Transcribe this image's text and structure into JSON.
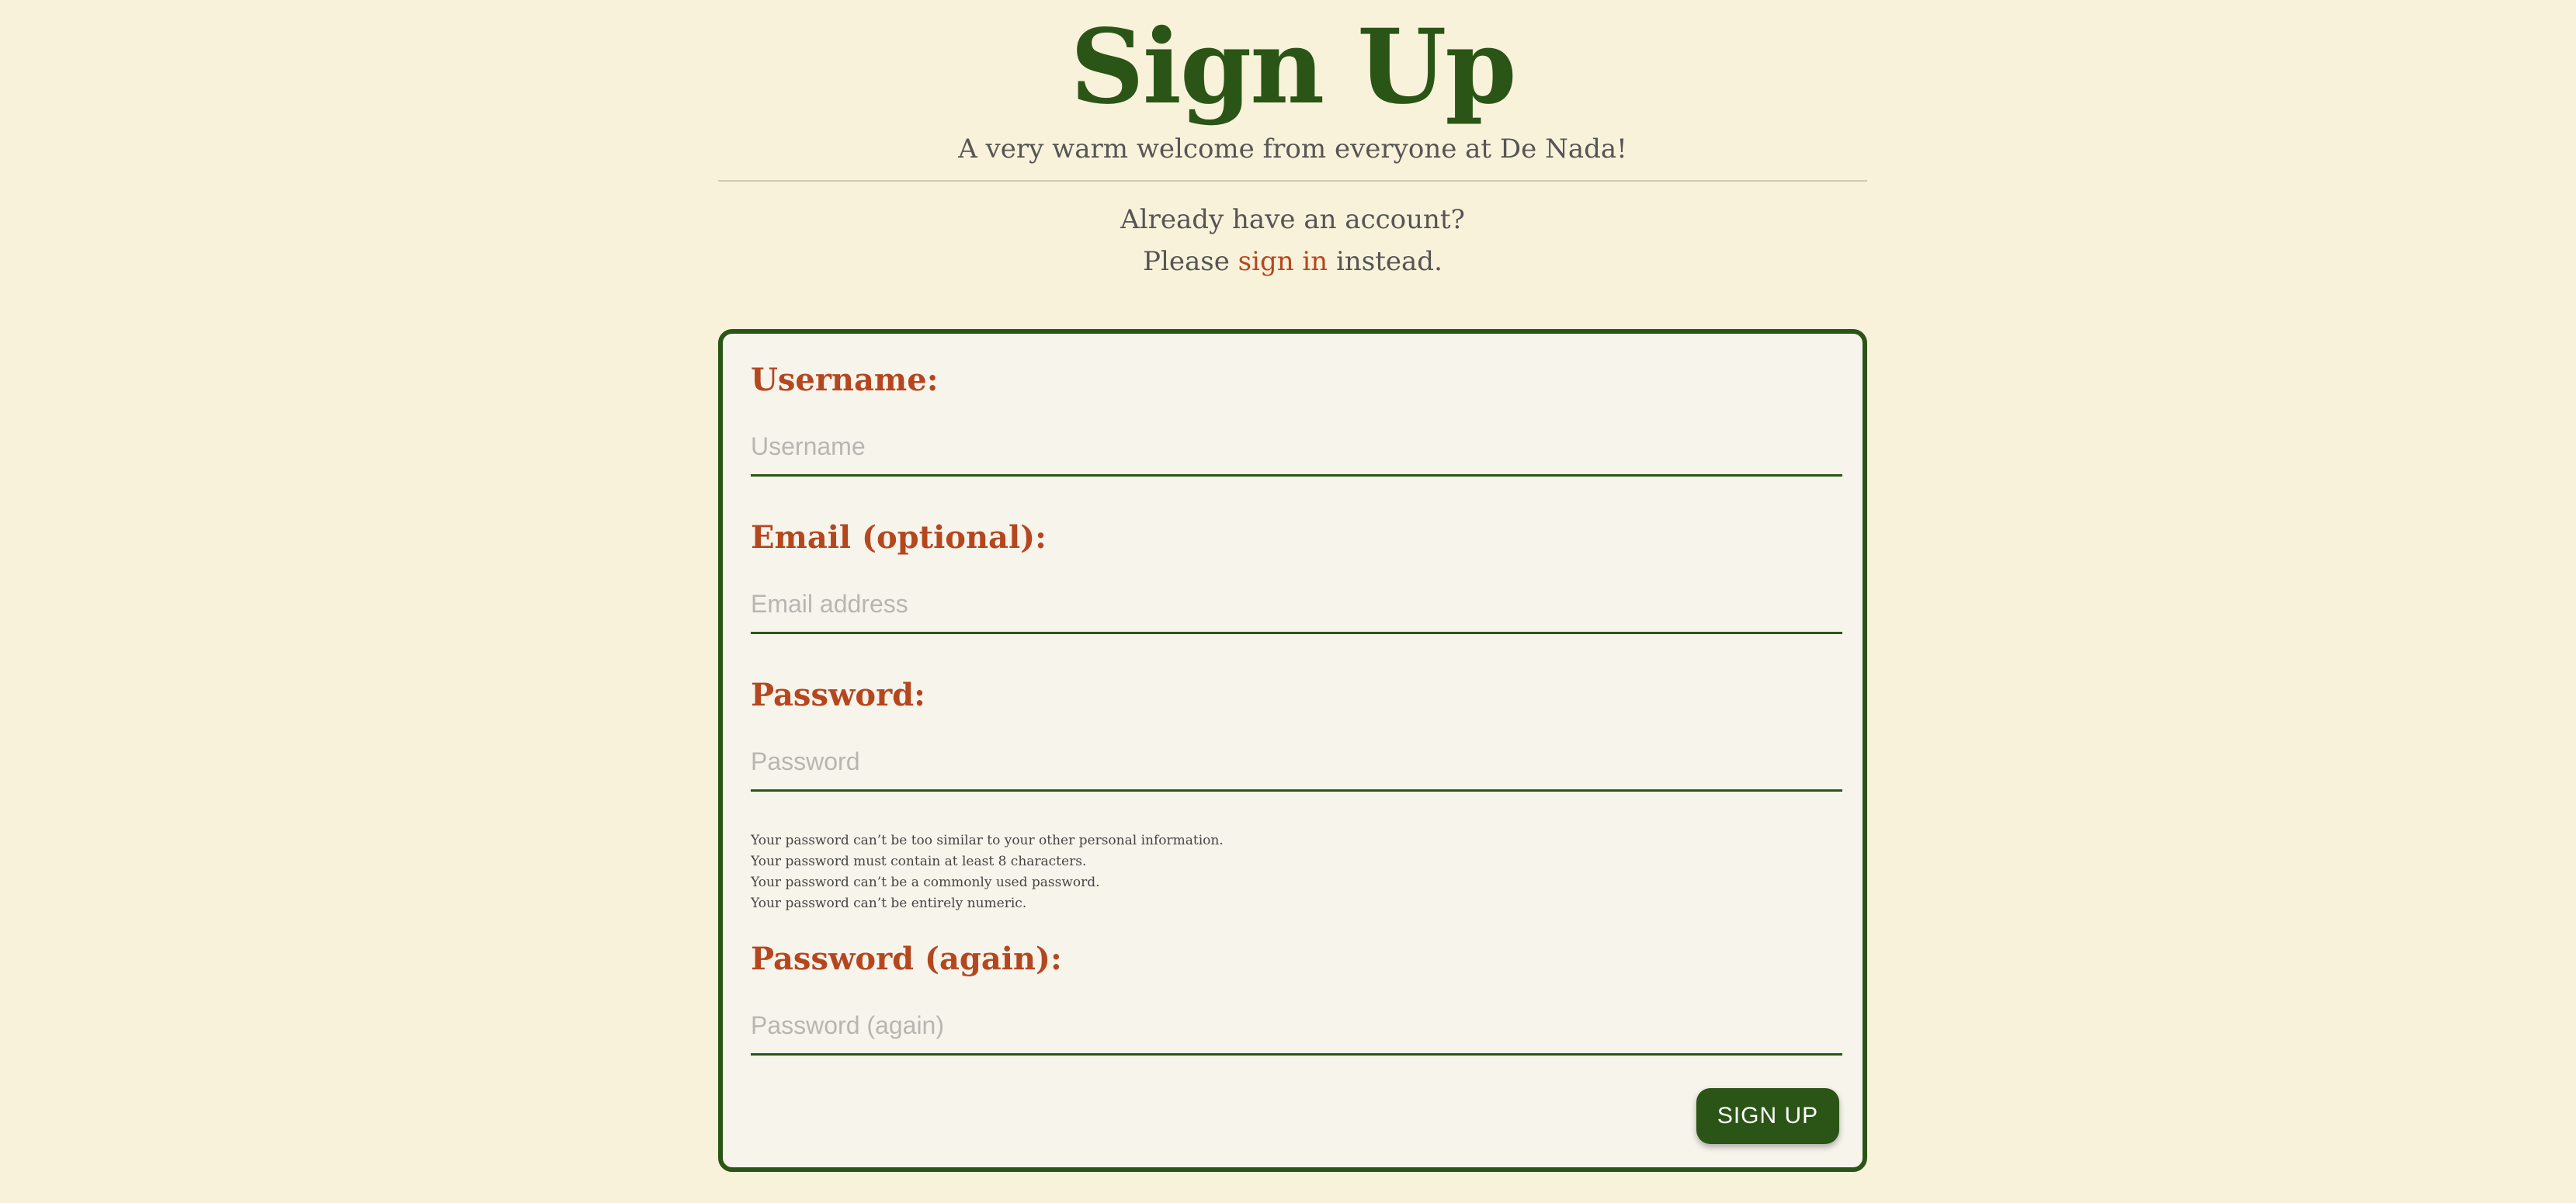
{
  "header": {
    "title": "Sign Up",
    "subtitle": "A very warm welcome from everyone at De Nada!"
  },
  "signin_prompt": {
    "line1": "Already have an account?",
    "line2_prefix": "Please",
    "link_text": "sign in",
    "line2_suffix": "instead."
  },
  "form": {
    "username": {
      "label": "Username:",
      "placeholder": "Username",
      "value": ""
    },
    "email": {
      "label": "Email (optional):",
      "placeholder": "Email address",
      "value": ""
    },
    "password": {
      "label": "Password:",
      "placeholder": "Password",
      "value": ""
    },
    "password_help": [
      "Your password can’t be too similar to your other personal information.",
      "Your password must contain at least 8 characters.",
      "Your password can’t be a commonly used password.",
      "Your password can’t be entirely numeric."
    ],
    "password_again": {
      "label": "Password (again):",
      "placeholder": "Password (again)",
      "value": ""
    },
    "submit_label": "SIGN UP"
  },
  "colors": {
    "background": "#f9f2da",
    "brand_green": "#2a5516",
    "accent_rust": "#b5471f",
    "card_background": "#f7f4ec"
  }
}
